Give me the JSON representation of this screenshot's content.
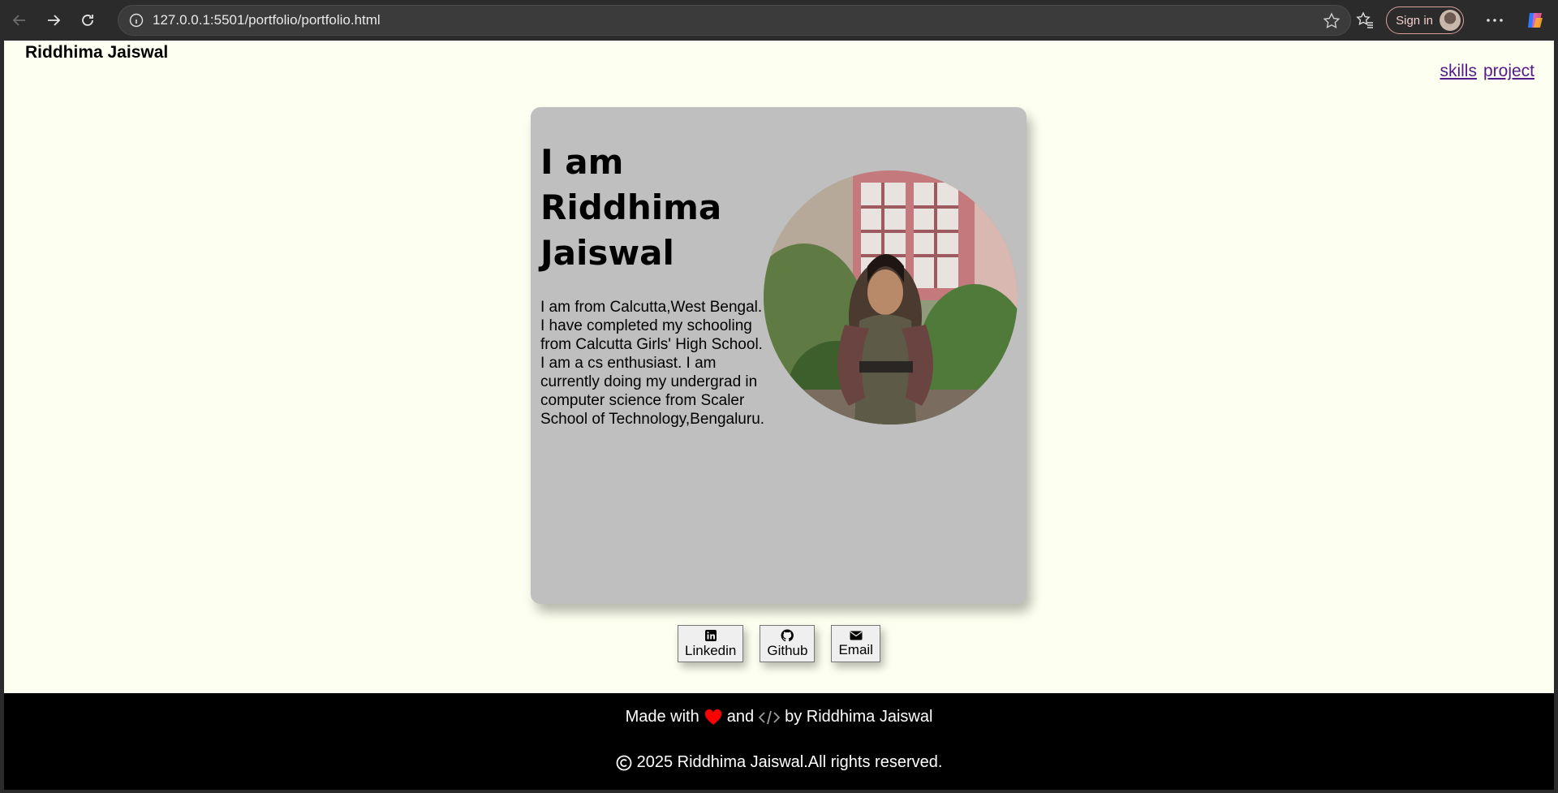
{
  "browser": {
    "url": "127.0.0.1:5501/portfolio/portfolio.html",
    "sign_in_label": "Sign in"
  },
  "header": {
    "site_name": "Riddhima Jaiswal",
    "nav": [
      {
        "label": "skills"
      },
      {
        "label": "project"
      }
    ]
  },
  "hero": {
    "title": "I am Riddhima Jaiswal",
    "bio": "I am from Calcutta,West Bengal. I have completed my schooling from Calcutta Girls' High School. I am a cs enthusiast. I am currently doing my undergrad in computer science from Scaler School of Technology,Bengaluru.",
    "photo_icon": "profile-photo"
  },
  "socials": [
    {
      "label": "Linkedin",
      "icon": "linkedin-icon"
    },
    {
      "label": "Github",
      "icon": "github-icon"
    },
    {
      "label": "Email",
      "icon": "envelope-icon"
    }
  ],
  "footer": {
    "made_with_pre": "Made with",
    "made_with_mid": "and",
    "made_with_post": "by Riddhima Jaiswal",
    "copyright": "2025 Riddhima Jaiswal.All rights reserved.",
    "heart_color": "#ff0000"
  },
  "colors": {
    "page_bg": "#fdfff0",
    "card_bg": "#bfbfbf",
    "link": "#551a8b",
    "footer_bg": "#000000"
  }
}
